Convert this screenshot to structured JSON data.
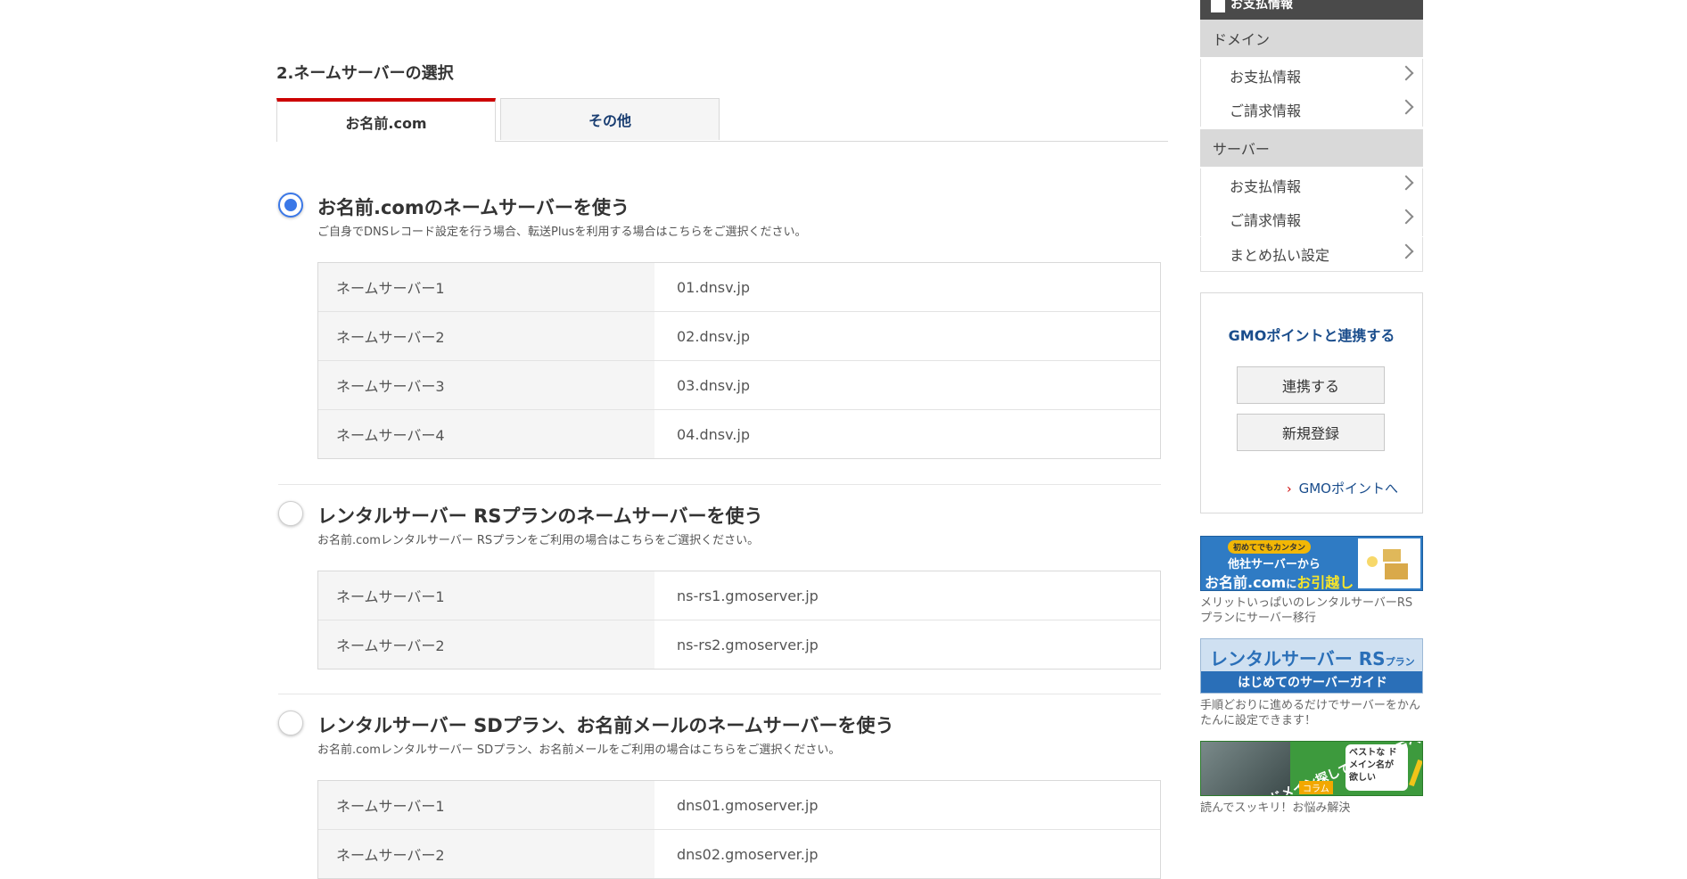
{
  "section_title": "2.ネームサーバーの選択",
  "tabs": [
    {
      "label": "お名前.com",
      "active": true
    },
    {
      "label": "その他",
      "active": false
    }
  ],
  "options": [
    {
      "title": "お名前.comのネームサーバーを使う",
      "description": "ご自身でDNSレコード設定を行う場合、転送Plusを利用する場合はこちらをご選択ください。",
      "selected": true,
      "servers": [
        {
          "label": "ネームサーバー1",
          "value": "01.dnsv.jp"
        },
        {
          "label": "ネームサーバー2",
          "value": "02.dnsv.jp"
        },
        {
          "label": "ネームサーバー3",
          "value": "03.dnsv.jp"
        },
        {
          "label": "ネームサーバー4",
          "value": "04.dnsv.jp"
        }
      ]
    },
    {
      "title": "レンタルサーバー RSプランのネームサーバーを使う",
      "description": "お名前.comレンタルサーバー RSプランをご利用の場合はこちらをご選択ください。",
      "selected": false,
      "servers": [
        {
          "label": "ネームサーバー1",
          "value": "ns-rs1.gmoserver.jp"
        },
        {
          "label": "ネームサーバー2",
          "value": "ns-rs2.gmoserver.jp"
        }
      ]
    },
    {
      "title": "レンタルサーバー SDプラン、お名前メールのネームサーバーを使う",
      "description": "お名前.comレンタルサーバー SDプラン、お名前メールをご利用の場合はこちらをご選択ください。",
      "selected": false,
      "servers": [
        {
          "label": "ネームサーバー1",
          "value": "dns01.gmoserver.jp"
        },
        {
          "label": "ネームサーバー2",
          "value": "dns02.gmoserver.jp"
        }
      ]
    }
  ],
  "sidebar": {
    "header": "お支払情報",
    "domain": {
      "label": "ドメイン",
      "items": [
        "お支払情報",
        "ご請求情報"
      ]
    },
    "server": {
      "label": "サーバー",
      "items": [
        "お支払情報",
        "ご請求情報",
        "まとめ払い設定"
      ]
    },
    "gmo": {
      "title": "GMOポイントと連携する",
      "link_button": "連携する",
      "register_button": "新規登録",
      "link": "GMOポイントへ"
    },
    "banners": [
      {
        "tag": "初めてでもカンタン",
        "line1": "他社サーバーから",
        "line2a": "お名前.com",
        "line2b": "に",
        "line2c": "お引越し",
        "caption": "メリットいっぱいのレンタルサーバーRSプランにサーバー移行"
      },
      {
        "line1": "レンタルサーバー RS",
        "line1_small": "プラン",
        "bar": "はじめてのサーバーガイド",
        "caption": "手順どおりに進めるだけでサーバーをかんたんに設定できます！"
      },
      {
        "line1": "ドメイン探しでお困りの方へ！",
        "col": "コラム",
        "bubble": "ベストな ドメイン名が 欲しい",
        "caption": "読んでスッキリ！お悩み解決"
      }
    ]
  },
  "colors": {
    "accent_red": "#cc0000",
    "radio_blue": "#3b78e7",
    "link_blue": "#1a4d8c"
  }
}
